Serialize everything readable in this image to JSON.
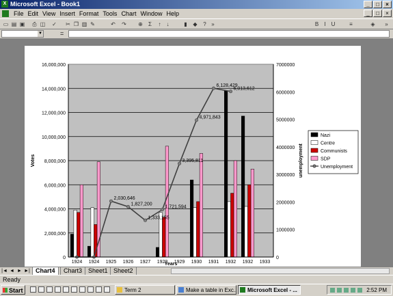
{
  "window": {
    "title": "Microsoft Excel - Book1"
  },
  "menu": {
    "items": [
      "File",
      "Edit",
      "View",
      "Insert",
      "Format",
      "Tools",
      "Chart",
      "Window",
      "Help"
    ]
  },
  "formula": {
    "eq": "="
  },
  "sheets": {
    "tabs": [
      "Chart4",
      "Chart3",
      "Sheet1",
      "Sheet2"
    ],
    "active": "Chart4"
  },
  "status": {
    "text": "Ready"
  },
  "taskbar": {
    "start": "Start",
    "tasks": [
      "Term 2",
      "Make a table in Exc...",
      "Microsoft Excel - ..."
    ],
    "clock": "2:52 PM"
  },
  "chart_data": {
    "type": "bar",
    "categories": [
      "1924",
      "1924",
      "1925",
      "1926",
      "1927",
      "1928",
      "1929",
      "1930",
      "1931",
      "1932",
      "1932",
      "1933"
    ],
    "xlabel": "Years",
    "ylabel": "Votes",
    "y2label": "unemployment",
    "ylim": [
      0,
      16000000
    ],
    "y2lim": [
      0,
      7000000
    ],
    "yticks": [
      "0",
      "2,000,000",
      "4,000,000",
      "6,000,000",
      "8,000,000",
      "10,000,000",
      "12,000,000",
      "14,000,000",
      "16,000,000"
    ],
    "y2ticks": [
      "0",
      "1000000",
      "2000000",
      "3000000",
      "4000000",
      "5000000",
      "6000000",
      "7000000"
    ],
    "grid": true,
    "legend": "right",
    "series": [
      {
        "name": "Nazi",
        "color": "#000000",
        "values": [
          1900000,
          900000,
          null,
          null,
          null,
          800000,
          null,
          6400000,
          null,
          13800000,
          11700000,
          null
        ]
      },
      {
        "name": "Centre",
        "color": "#ffffff",
        "values": [
          3900000,
          4100000,
          null,
          null,
          null,
          3700000,
          null,
          4100000,
          null,
          4600000,
          4200000,
          null
        ]
      },
      {
        "name": "Communists",
        "color": "#cc0000",
        "values": [
          3700000,
          2700000,
          null,
          null,
          null,
          3300000,
          null,
          4600000,
          null,
          5300000,
          6000000,
          null
        ]
      },
      {
        "name": "SDP",
        "color": "#ff99cc",
        "values": [
          6000000,
          7900000,
          null,
          null,
          null,
          9200000,
          null,
          8600000,
          null,
          8000000,
          7300000,
          null
        ]
      }
    ],
    "line": {
      "name": "Unemployment",
      "color": "#404040",
      "values": [
        0,
        0,
        2030646,
        1827200,
        1333155,
        1721594,
        3395811,
        4971843,
        6128429,
        6013612,
        null,
        null
      ],
      "labels": [
        "",
        "",
        "2,030,646",
        "1,827,200",
        "1,333,155",
        "1,721,594",
        "3,395,811",
        "4,971,843",
        "6,128,429",
        "6,013,612",
        "",
        ""
      ]
    }
  }
}
